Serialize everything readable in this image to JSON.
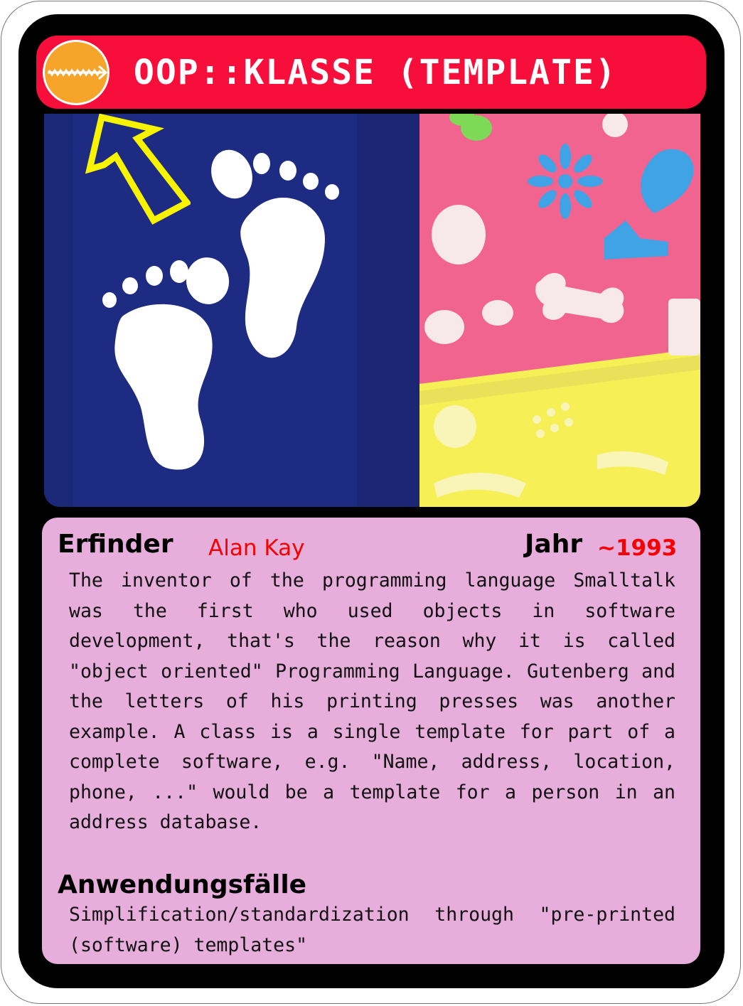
{
  "card": {
    "title": "OOP::KLASSE (TEMPLATE)",
    "badge_icon": "zipper-icon",
    "arrow_icon": "yellow-arrow-icon",
    "colors": {
      "title_bar": "#f70e3a",
      "badge": "#f6a52a",
      "info_panel": "#e7aedc",
      "accent_text": "#f70000",
      "arrow": "#f8f400",
      "left_image_bg": "#1e2b82"
    }
  },
  "images": {
    "left": "footprints-image",
    "right": "stencil-templates-image"
  },
  "info": {
    "inventor_label": "Erfinder",
    "inventor_value": "Alan Kay",
    "year_label": "Jahr",
    "year_value": "~1993",
    "description": "The inventor of the programming language Smalltalk was the first who used objects in software development, that's the reason why it is called \"object oriented\" Programming Language. Gutenberg and the letters of his printing presses was another example. A class is a single template for part of a complete software, e.g. \"Name, address, location, phone, ...\" would be a template for a person in an address database.",
    "uses_label": "Anwendungsfälle",
    "uses_text": "Simplification/standardization through \"pre-printed (software) templates\""
  }
}
